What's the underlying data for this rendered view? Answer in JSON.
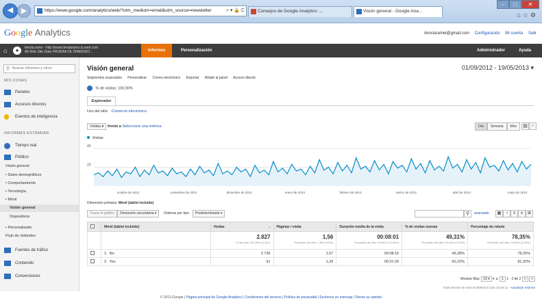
{
  "browser": {
    "url": "https://www.google.com/analytics/web/?utm_medium=email&utm_source=newsletter",
    "tabs": [
      {
        "label": "Consejos de Google Analytics: ..."
      },
      {
        "label": "Visión general - Google Ana..."
      }
    ]
  },
  "header": {
    "logo_google": "Google",
    "logo_product": "Analytics",
    "email": "rlenciaramel@gmail.com",
    "config": "Configuración",
    "account": "Mi cuenta",
    "logout": "Salir"
  },
  "navbar": {
    "account_line1": "tienda.ramo - http://www.tiendaramo.tu.web.com",
    "account_line2": "All Web Site Data PRUEBA DE DIMENSIO...",
    "informes": "Informes",
    "personalizacion": "Personalización",
    "administrador": "Administrador",
    "ayuda": "Ayuda"
  },
  "sidebar": {
    "search_placeholder": "Buscar informes y otros",
    "mis_cosas": "MIS COSAS",
    "paneles": "Paneles",
    "accesos": "Accesos directos",
    "eventos": "Eventos de inteligencia",
    "informes_estandar": "INFORMES ESTÁNDAR",
    "tiempo_real": "Tiempo real",
    "publico": "Público",
    "vision_general": "Visión general",
    "datos_demograficos": "• Datos demográficos",
    "comportamiento": "• Comportamiento",
    "tecnologia": "• Tecnología",
    "movil": "• Móvil",
    "movil_vision": "Visión general",
    "dispositivos": "Dispositivos",
    "personalizado": "• Personalizado",
    "flujo": "Flujo de visitantes",
    "fuentes": "Fuentes de tráfico",
    "contenido": "Contenido",
    "conversiones": "Conversiones"
  },
  "main": {
    "title": "Visión general",
    "date_range": "01/09/2012 - 19/05/2013",
    "toolbar": [
      "Segmentos avanzados",
      "Personalizar",
      "Correo electrónico",
      "Exportar",
      "Añadir al panel",
      "Acceso directo"
    ],
    "pct_visits": "% de visitas: 100,00%",
    "explorer_tab": "Explorador",
    "subtab_label": "Uso del sitio",
    "subtab_link": "Comercio electrónico",
    "metric_select": "Visitas",
    "versus": "frente a",
    "select_metric": "Seleccione una métrica",
    "gran_day": "Día",
    "gran_week": "Semana",
    "gran_month": "Mes",
    "legend": "Visitas",
    "dim_primary_label": "Dimensión primaria:",
    "dim_primary_value": "Móvil (tablet incluido)",
    "btn_grafico": "Trazar el gráfico",
    "btn_secundaria": "Dimensión secundaria",
    "ordenar": "Ordenar por tipo:",
    "predeterminado": "Predeterminado",
    "avanzado": "avanzado"
  },
  "chart_data": {
    "type": "line",
    "ylabel": "Visitas",
    "yticks": [
      40,
      20
    ],
    "ylim": [
      0,
      45
    ],
    "xticks": [
      "octubre de 2012",
      "noviembre de 2012",
      "diciembre de 2012",
      "enero de 2013",
      "febrero de 2013",
      "marzo de 2013",
      "abril de 2013",
      "mayo de 2013"
    ],
    "series": [
      {
        "name": "Visitas",
        "color": "#058dc7",
        "values": [
          12,
          14,
          10,
          16,
          11,
          18,
          9,
          15,
          13,
          20,
          10,
          17,
          12,
          22,
          14,
          16,
          11,
          19,
          13,
          15,
          10,
          18,
          12,
          21,
          14,
          17,
          11,
          24,
          13,
          16,
          12,
          20,
          15,
          18,
          10,
          22,
          14,
          17,
          12,
          26,
          15,
          19,
          13,
          23,
          16,
          18,
          12,
          21,
          14,
          28,
          17,
          20,
          13,
          25,
          16,
          22,
          14,
          30,
          18,
          21,
          15,
          27,
          17,
          23,
          13,
          26,
          19,
          22,
          15,
          29,
          18,
          24,
          14,
          27,
          17,
          21,
          16,
          31,
          19,
          23,
          15,
          28,
          18,
          25,
          14,
          30,
          20,
          22,
          16,
          27,
          17,
          24,
          15,
          26,
          18,
          23
        ]
      }
    ]
  },
  "table": {
    "headers": [
      "Móvil (tablet incluido)",
      "Visitas",
      "Páginas / visita",
      "Duración media de la visita",
      "% de visitas nuevas",
      "Porcentaje de rebote"
    ],
    "totals": {
      "visitas": "2.827",
      "visitas_sub": "% del total: 100,00% (2.827)",
      "paginas": "1,56",
      "paginas_sub": "Promedio del sitio: 1,56 (0,00%)",
      "duracion": "00:08:01",
      "duracion_sub": "Promedio del sitio: 00:08:01 (0,00%)",
      "nuevas": "49,31%",
      "nuevas_sub": "Promedio del sitio: 49,24% (0,15%)",
      "rebote": "78,35%",
      "rebote_sub": "Promedio del sitio: 78,35% (0,00%)"
    },
    "rows": [
      {
        "n": "1.",
        "label": "No",
        "visitas": "2.736",
        "paginas": "1,57",
        "duracion": "00:08:16",
        "nuevas": "49,28%",
        "rebote": "78,25%"
      },
      {
        "n": "2.",
        "label": "Yes",
        "visitas": "91",
        "paginas": "1,29",
        "duracion": "00:01:20",
        "nuevas": "60,22%",
        "rebote": "81,32%"
      }
    ]
  },
  "pagination": {
    "label": "Mostrar filas:",
    "rows": "10",
    "goto": "Ir a:",
    "page": "1",
    "range": "1 - 2 de 2"
  },
  "report_note": "Este informe se creó el 20/05/13 a las 10:46:11 -",
  "report_link": "Actualizar informe",
  "footer": {
    "copyright": "© 2013 Google",
    "links": "Página principal de Google Analytics | Condiciones del servicio | Política de privacidad | Envíenos un mensaje | Denos su opinión"
  }
}
